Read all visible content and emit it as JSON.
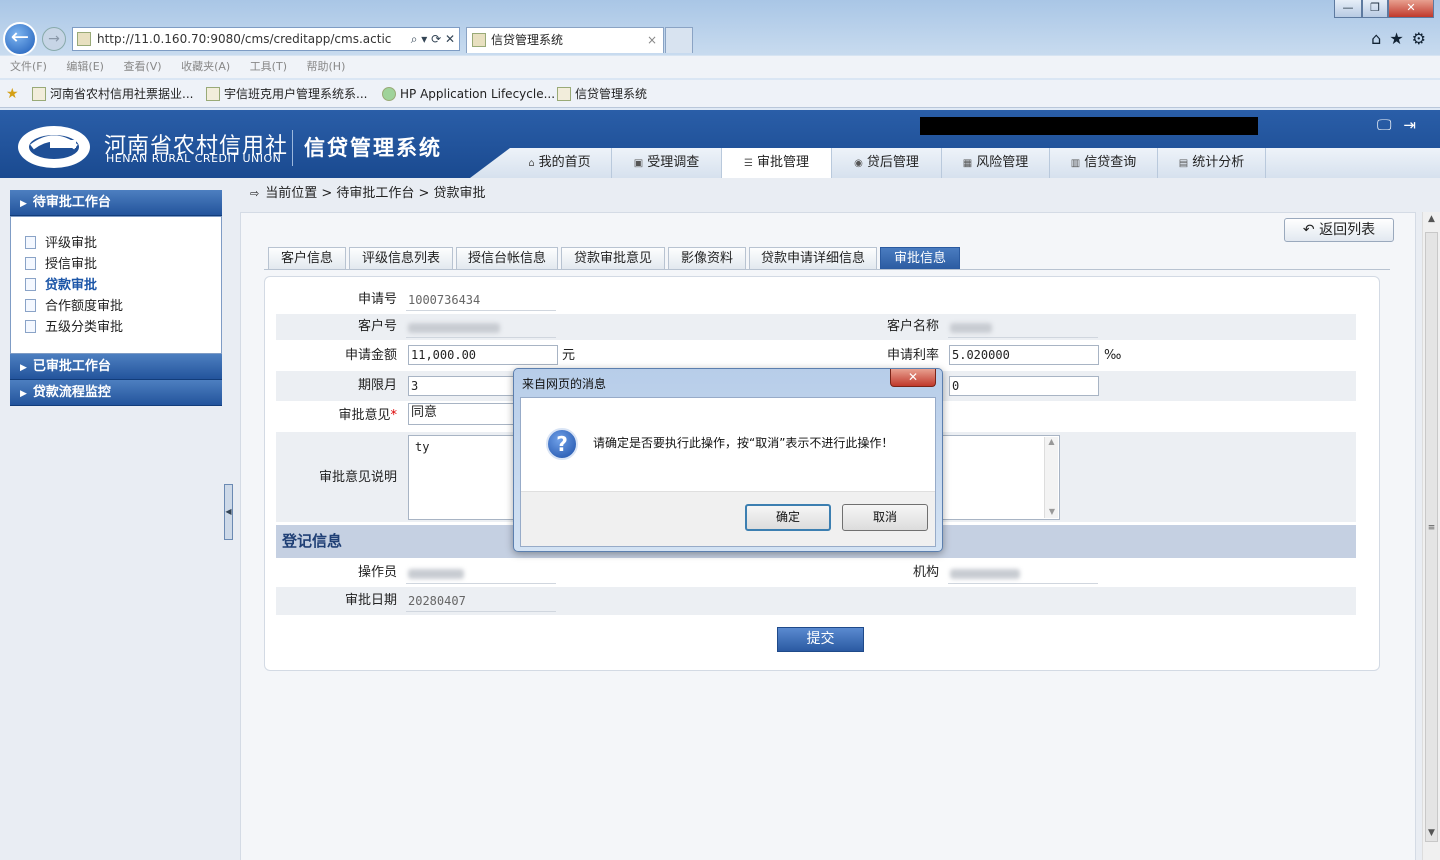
{
  "browser": {
    "address": "http://11.0.160.70:9080/cms/creditapp/cms.actic",
    "tab_title": "信贷管理系统",
    "window_controls": [
      "—",
      "❐",
      "✕"
    ],
    "menu": [
      "文件(F)",
      "编辑(E)",
      "查看(V)",
      "收藏夹(A)",
      "工具(T)",
      "帮助(H)"
    ],
    "favorites": [
      "河南省农村信用社票据业...",
      "宇信班克用户管理系统系...",
      "HP Application Lifecycle...",
      "信贷管理系统"
    ]
  },
  "app": {
    "brand_cn": "河南省农村信用社",
    "brand_en": "HENAN RURAL CREDIT UNION",
    "system_name": "信贷管理系统",
    "nav": [
      "我的首页",
      "受理调查",
      "审批管理",
      "贷后管理",
      "风险管理",
      "信贷查询",
      "统计分析"
    ],
    "nav_active": "审批管理"
  },
  "sidebar": {
    "section1": "待审批工作台",
    "items": [
      "评级审批",
      "授信审批",
      "贷款审批",
      "合作额度审批",
      "五级分类审批"
    ],
    "active_item": "贷款审批",
    "section2": "已审批工作台",
    "section3": "贷款流程监控"
  },
  "breadcrumb": "当前位置 > 待审批工作台 > 贷款审批",
  "back_button": "返回列表",
  "content_tabs": [
    "客户信息",
    "评级信息列表",
    "授信台帐信息",
    "贷款审批意见",
    "影像资料",
    "贷款申请详细信息",
    "审批信息"
  ],
  "content_tab_active": "审批信息",
  "form": {
    "application_no_label": "申请号",
    "application_no": "1000736434",
    "customer_no_label": "客户号",
    "customer_name_label": "客户名称",
    "amount_label": "申请金额",
    "amount": "11,000.00",
    "amount_unit": "元",
    "rate_label": "申请利率",
    "rate": "5.020000",
    "rate_unit": "‰",
    "term_label": "期限月",
    "term": "3",
    "term_right_value": "0",
    "opinion_label": "审批意见",
    "opinion": "同意",
    "opinion_desc_label": "审批意见说明",
    "opinion_desc": "ty",
    "section_title": "登记信息",
    "operator_label": "操作员",
    "org_label": "机构",
    "date_label": "审批日期",
    "date": "20280407",
    "submit": "提交"
  },
  "dialog": {
    "title": "来自网页的消息",
    "message": "请确定是否要执行此操作，按“取消”表示不进行此操作！",
    "ok": "确定",
    "cancel": "取消"
  }
}
